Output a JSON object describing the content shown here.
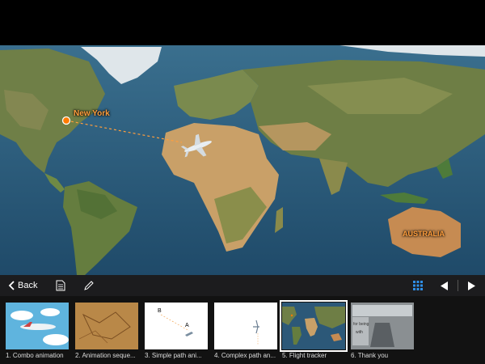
{
  "map": {
    "city_label": "New York",
    "country_label": "AUSTRALIA"
  },
  "toolbar": {
    "back_label": "Back"
  },
  "slides": [
    {
      "caption": "1. Combo animation"
    },
    {
      "caption": "2. Animation seque..."
    },
    {
      "caption": "3. Simple path ani..."
    },
    {
      "caption": "4. Complex path an..."
    },
    {
      "caption": "5. Flight tracker",
      "selected": true
    },
    {
      "caption": "6. Thank you"
    }
  ],
  "slide3_label_b": "B",
  "slide3_label_a": "A",
  "slide6_text": [
    "for being",
    "with"
  ],
  "colors": {
    "ocean": "#2c5878",
    "land": "#7f8a4a",
    "desert": "#c9a068",
    "accent": "#ff9e3d",
    "toolbar_bg": "#1c1c1e",
    "grid_icon": "#2f8fe8"
  }
}
